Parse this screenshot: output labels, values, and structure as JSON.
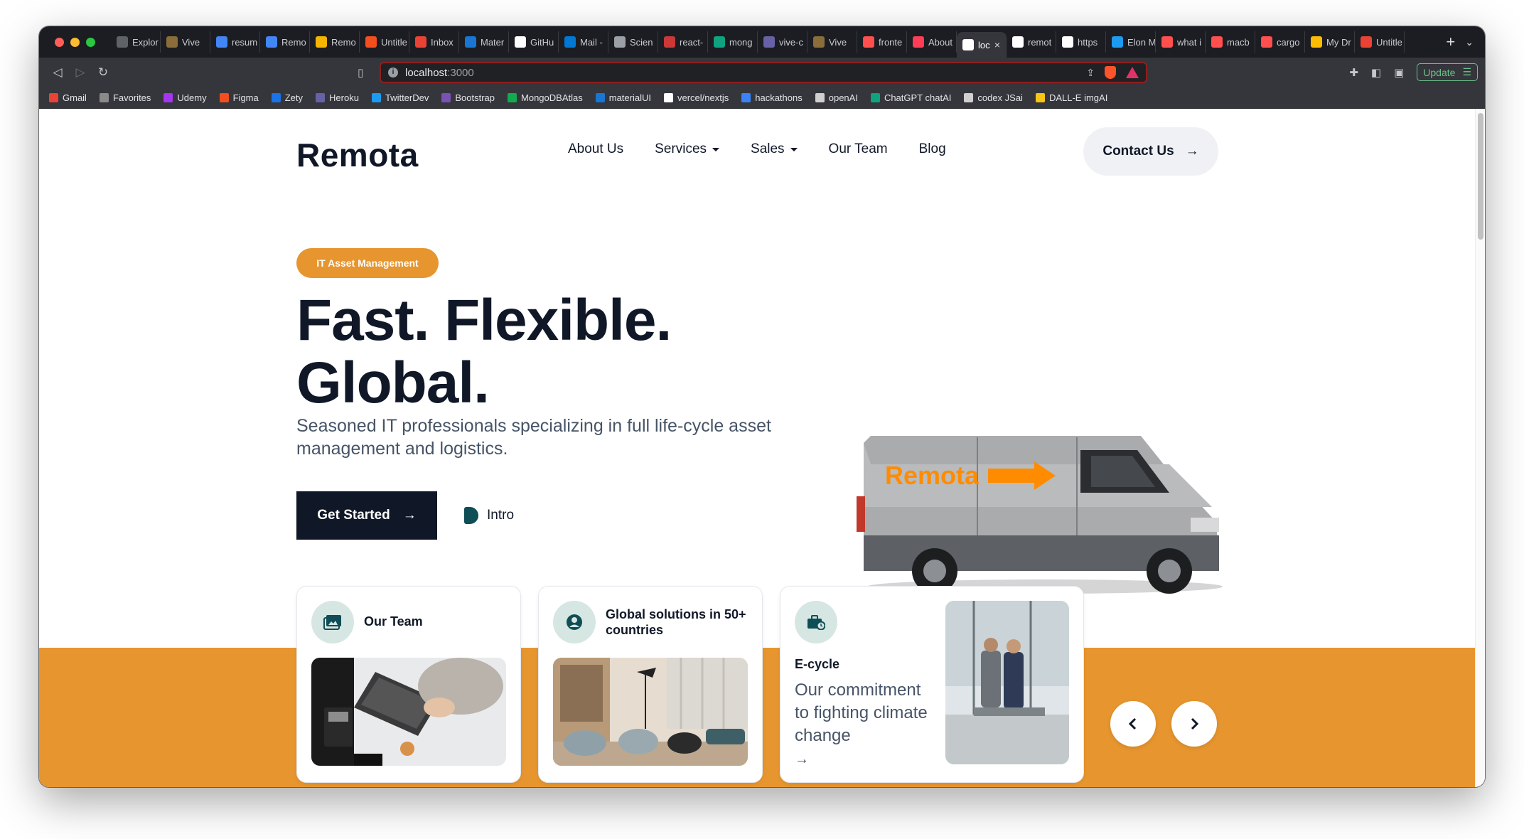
{
  "browser": {
    "tabs": [
      {
        "label": "Explor",
        "icon": "a-icon",
        "color": "#5f6368"
      },
      {
        "label": "Vive",
        "icon": "image-icon",
        "color": "#8a6d3b"
      },
      {
        "label": "resum",
        "icon": "docs-icon",
        "color": "#4285f4"
      },
      {
        "label": "Remo",
        "icon": "docs-icon",
        "color": "#4285f4"
      },
      {
        "label": "Remo",
        "icon": "slides-icon",
        "color": "#f4b400"
      },
      {
        "label": "Untitle",
        "icon": "figma-icon",
        "color": "#f24e1e"
      },
      {
        "label": "Inbox",
        "icon": "gmail-icon",
        "color": "#ea4335"
      },
      {
        "label": "Mater",
        "icon": "mui-icon",
        "color": "#1976d2"
      },
      {
        "label": "GitHu",
        "icon": "github-icon",
        "color": "#ffffff"
      },
      {
        "label": "Mail -",
        "icon": "outlook-icon",
        "color": "#0078d4"
      },
      {
        "label": "Scien",
        "icon": "globe-icon",
        "color": "#9aa0a6"
      },
      {
        "label": "react-",
        "icon": "npm-icon",
        "color": "#cb3837"
      },
      {
        "label": "mong",
        "icon": "chatgpt-icon",
        "color": "#10a37f"
      },
      {
        "label": "vive-c",
        "icon": "heroku-icon",
        "color": "#6762a6"
      },
      {
        "label": "Vive",
        "icon": "image-icon",
        "color": "#8a6d3b"
      },
      {
        "label": "fronte",
        "icon": "search-icon",
        "color": "#ff4f4f"
      },
      {
        "label": "About",
        "icon": "monday-icon",
        "color": "#ff3d57"
      },
      {
        "label": "loc",
        "icon": "vercel-icon",
        "color": "#ffffff",
        "active": true
      },
      {
        "label": "remot",
        "icon": "vercel-icon",
        "color": "#ffffff"
      },
      {
        "label": "https",
        "icon": "vercel-icon",
        "color": "#ffffff"
      },
      {
        "label": "Elon M",
        "icon": "twitter-icon",
        "color": "#1d9bf0"
      },
      {
        "label": "what i",
        "icon": "search-icon",
        "color": "#ff4f4f"
      },
      {
        "label": "macb",
        "icon": "search-icon",
        "color": "#ff4f4f"
      },
      {
        "label": "cargo",
        "icon": "search-icon",
        "color": "#ff4f4f"
      },
      {
        "label": "My Dr",
        "icon": "drive-icon",
        "color": "#fbbc04"
      },
      {
        "label": "Untitle",
        "icon": "plus-icon",
        "color": "#ea4335"
      }
    ],
    "url_host": "localhost",
    "url_port": ":3000",
    "update_label": "Update",
    "bookmarks": [
      {
        "label": "Gmail",
        "color": "#ea4335"
      },
      {
        "label": "Favorites",
        "color": "#8a8a8a"
      },
      {
        "label": "Udemy",
        "color": "#a435f0"
      },
      {
        "label": "Figma",
        "color": "#f24e1e"
      },
      {
        "label": "Zety",
        "color": "#1a73e8"
      },
      {
        "label": "Heroku",
        "color": "#6762a6"
      },
      {
        "label": "TwitterDev",
        "color": "#1d9bf0"
      },
      {
        "label": "Bootstrap",
        "color": "#7952b3"
      },
      {
        "label": "MongoDBAtlas",
        "color": "#13aa52"
      },
      {
        "label": "materialUI",
        "color": "#1976d2"
      },
      {
        "label": "vercel/nextjs",
        "color": "#ffffff"
      },
      {
        "label": "hackathons",
        "color": "#3b82f6"
      },
      {
        "label": "openAI",
        "color": "#d0d0d0"
      },
      {
        "label": "ChatGPT chatAI",
        "color": "#10a37f"
      },
      {
        "label": "codex JSai",
        "color": "#d0d0d0"
      },
      {
        "label": "DALL-E imgAI",
        "color": "#f5c518"
      }
    ]
  },
  "site": {
    "logo": "Remota",
    "nav": [
      {
        "label": "About Us",
        "dropdown": false
      },
      {
        "label": "Services",
        "dropdown": true
      },
      {
        "label": "Sales",
        "dropdown": true
      },
      {
        "label": "Our Team",
        "dropdown": false
      },
      {
        "label": "Blog",
        "dropdown": false
      }
    ],
    "contact_label": "Contact Us",
    "badge": "IT Asset Management",
    "headline_line1": "Fast. Flexible.",
    "headline_line2": "Global.",
    "subtitle": "Seasoned IT professionals specializing in full life-cycle asset management and logistics.",
    "get_started": "Get Started",
    "intro": "Intro",
    "van_text": "Remota",
    "cards": [
      {
        "title": "Our Team",
        "icon": "gallery-icon"
      },
      {
        "title": "Global solutions in 50+ countries",
        "icon": "user-circle-icon"
      },
      {
        "title": "E-cycle",
        "icon": "briefcase-clock-icon",
        "body": "Our commitment to fighting climate change",
        "link": "→"
      }
    ],
    "colors": {
      "accent": "#e6952f",
      "dark": "#101828",
      "icon_bg": "#d6e6e2",
      "icon_fg": "#0f4d57"
    }
  }
}
